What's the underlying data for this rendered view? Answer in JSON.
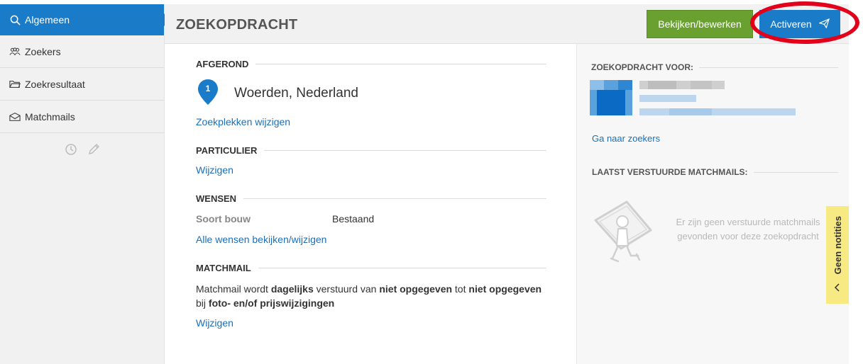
{
  "sidebar": {
    "items": [
      {
        "label": "Algemeen",
        "icon": "search-icon",
        "active": true
      },
      {
        "label": "Zoekers",
        "icon": "users-icon",
        "active": false
      },
      {
        "label": "Zoekresultaat",
        "icon": "folder-icon",
        "active": false
      },
      {
        "label": "Matchmails",
        "icon": "envelope-icon",
        "active": false
      }
    ],
    "tools": [
      "clock-icon",
      "pencil-icon"
    ]
  },
  "header": {
    "title": "ZOEKOPDRACHT",
    "edit_label": "Bekijken/bewerken",
    "activate_label": "Activeren"
  },
  "main": {
    "status_heading": "AFGEROND",
    "location": {
      "number": "1",
      "name": "Woerden, Nederland"
    },
    "change_locations_link": "Zoekplekken wijzigen",
    "particulier_heading": "PARTICULIER",
    "particulier_link": "Wijzigen",
    "wishes_heading": "WENSEN",
    "wishes": [
      {
        "label": "Soort bouw",
        "value": "Bestaand"
      }
    ],
    "wishes_link": "Alle wensen bekijken/wijzigen",
    "matchmail_heading": "MATCHMAIL",
    "matchmail_text": {
      "p1": "Matchmail wordt ",
      "b1": "dagelijks",
      "p2": " verstuurd van ",
      "b2": "niet opgegeven",
      "p3": " tot ",
      "b3": "niet opgegeven",
      "p4": "bij ",
      "b4": "foto- en/of prijswijzigingen"
    },
    "matchmail_link": "Wijzigen"
  },
  "right": {
    "for_heading": "ZOEKOPDRACHT VOOR:",
    "go_to_seekers_link": "Ga naar zoekers",
    "last_matchmails_heading": "LAATST VERSTUURDE MATCHMAILS:",
    "empty_message": "Er zijn geen verstuurde matchmails gevonden voor deze zoekopdracht"
  },
  "notes_tab": {
    "label": "Geen notities"
  },
  "colors": {
    "accent_blue": "#1a7bc8",
    "edit_green": "#6aa030",
    "highlight_red": "#e3001b",
    "notes_yellow": "#f7ea83"
  }
}
